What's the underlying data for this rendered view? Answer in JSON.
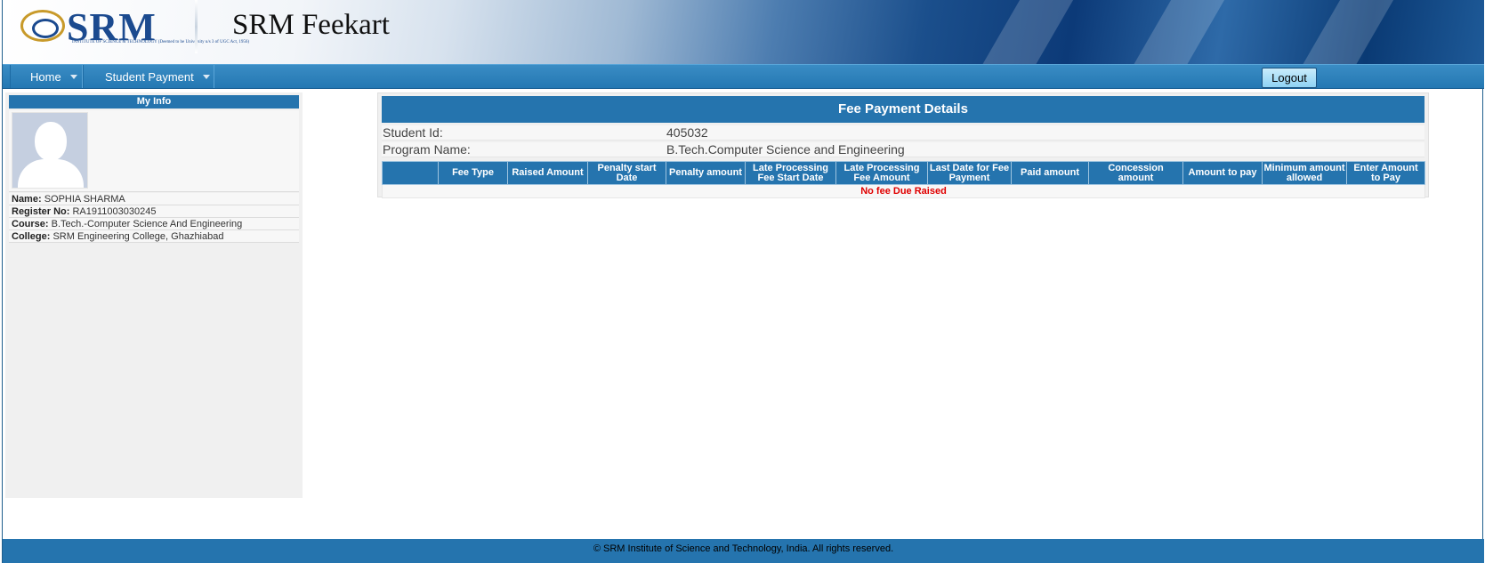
{
  "header": {
    "logo_text": "SRM",
    "logo_sub": "INSTITUTE OF SCIENCE & TECHNOLOGY (Deemed to be University u/s 3 of UGC Act, 1956)",
    "app_title": "SRM Feekart"
  },
  "menu": {
    "items": [
      {
        "label": "Home"
      },
      {
        "label": "Student Payment"
      }
    ],
    "logout_label": "Logout"
  },
  "my_info": {
    "title": "My Info",
    "fields": [
      {
        "label": "Name:",
        "value": "SOPHIA SHARMA"
      },
      {
        "label": "Register No:",
        "value": "RA1911003030245"
      },
      {
        "label": "Course:",
        "value": "B.Tech.-Computer Science And Engineering"
      },
      {
        "label": "College:",
        "value": "SRM Engineering College, Ghazhiabad"
      }
    ]
  },
  "fee_payment": {
    "title": "Fee Payment Details",
    "student_id_label": "Student Id:",
    "student_id_value": "405032",
    "program_label": "Program Name:",
    "program_value": "B.Tech.Computer Science and Engineering",
    "columns": [
      "",
      "Fee Type",
      "Raised Amount",
      "Penalty start Date",
      "Penalty amount",
      "Late Processing Fee Start Date",
      "Late Processing Fee Amount",
      "Last Date for Fee Payment",
      "Paid amount",
      "Concession amount",
      "Amount to pay",
      "Minimum amount allowed",
      "Enter Amount to Pay"
    ],
    "empty_message": "No fee Due Raised"
  },
  "footer": {
    "text": "© SRM Institute of Science and Technology, India. All rights reserved."
  },
  "colors": {
    "accent_blue": "#2574ae",
    "alert_red": "#e00000",
    "logout_bg": "#8fd3f4"
  }
}
